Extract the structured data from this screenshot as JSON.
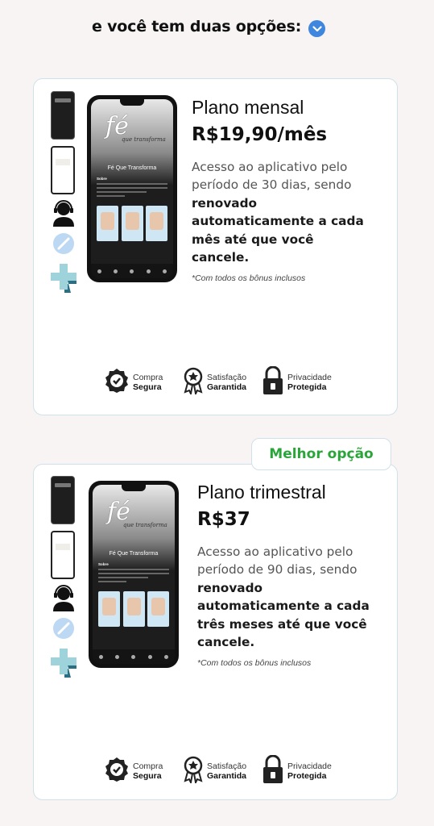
{
  "header": {
    "text": "e você tem duas opções:"
  },
  "plans": [
    {
      "name": "Plano mensal",
      "price": "R$19,90/mês",
      "desc_intro": "Acesso ao aplicativo pelo período de 30 dias, sendo",
      "desc_bold": "renovado automaticamente a cada mês até que você cancele.",
      "note": "*Com todos os bônus inclusos"
    },
    {
      "name": "Plano trimestral",
      "price": "R$37",
      "desc_intro": "Acesso ao aplicativo pelo período de 90 dias, sendo",
      "desc_bold": "renovado automaticamente a cada três meses até que você cancele.",
      "note": "*Com todos os bônus inclusos"
    }
  ],
  "badge": {
    "label": "Melhor opção"
  },
  "phone": {
    "logo": "fé",
    "logo_sub": "que transforma",
    "title": "Fé Que Transforma",
    "about": "Sobre"
  },
  "trust": {
    "secure_top": "Compra",
    "secure_bottom": "Segura",
    "satisfaction_top": "Satisfação",
    "satisfaction_bottom": "Garantida",
    "privacy_top": "Privacidade",
    "privacy_bottom": "Protegida"
  },
  "colors": {
    "accent_blue": "#3f86de",
    "badge_green": "#2aa53a",
    "card_border": "#cfe1ea"
  }
}
